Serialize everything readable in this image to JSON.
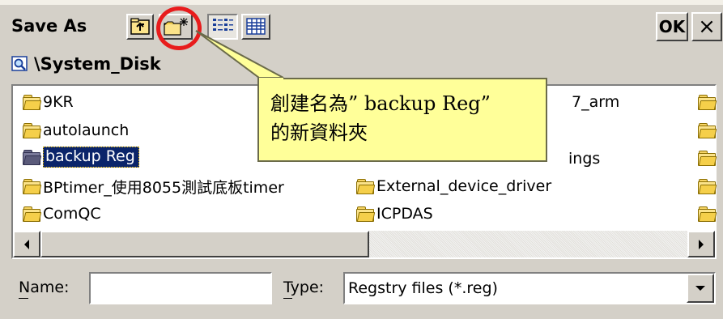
{
  "window": {
    "title": "Save As",
    "ok_label": "OK",
    "close_label": "×"
  },
  "path": {
    "text": "\\System_Disk"
  },
  "files": {
    "col1": [
      {
        "name": "9KR",
        "selected": false
      },
      {
        "name": "autolaunch",
        "selected": false
      },
      {
        "name": "backup Reg",
        "selected": true
      },
      {
        "name": "BPtimer_使用8055測試底板timer",
        "selected": false
      },
      {
        "name": "ComQC",
        "selected": false
      }
    ],
    "col2_partial": [
      {
        "name": "7_arm"
      },
      {
        "name": "ings"
      },
      {
        "name": "External_device_driver"
      },
      {
        "name": "ICPDAS"
      }
    ]
  },
  "callout": {
    "line1": "創建名為” backup Reg”",
    "line2": "的新資料夾"
  },
  "form": {
    "name_label": "Name:",
    "name_value": "",
    "type_label": "Type:",
    "type_value": "Regstry files (*.reg)"
  },
  "icons": {
    "up_folder": "up-folder-icon",
    "new_folder": "new-folder-icon",
    "list_view": "list-view-icon",
    "details_view": "details-view-icon",
    "search": "search-folder-icon"
  },
  "colors": {
    "selection": "#0a246a",
    "callout_bg": "#ffff99",
    "highlight_circle": "#e81c1c"
  }
}
